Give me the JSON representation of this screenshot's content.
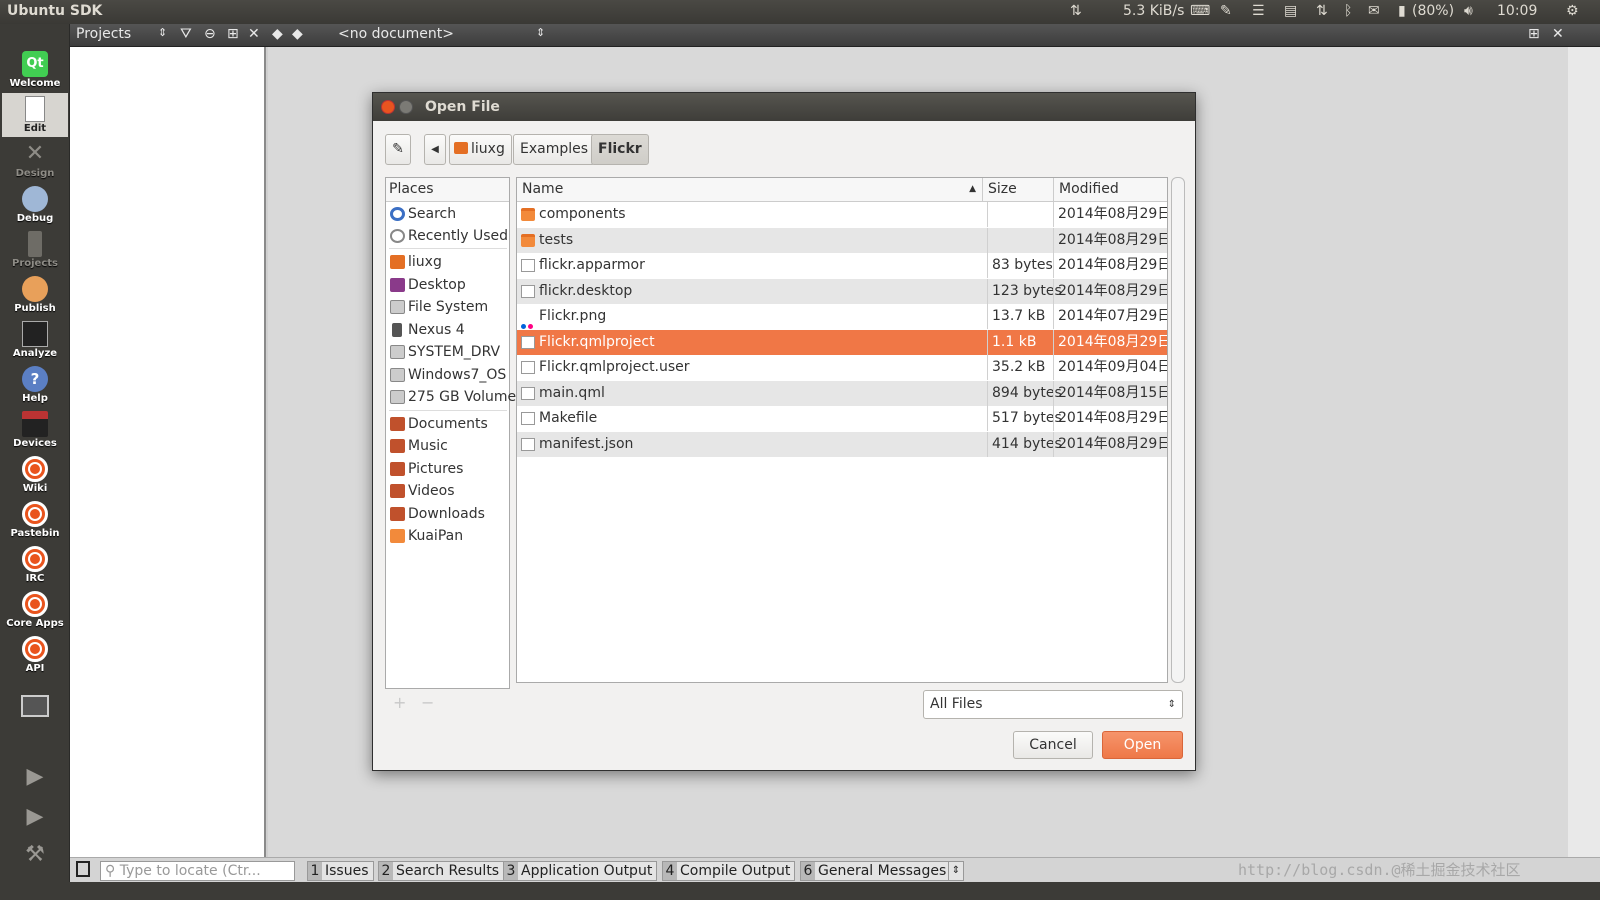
{
  "topbar": {
    "app_name": "Ubuntu SDK",
    "net_speed": "5.3 KiB/s",
    "battery": "(80%)",
    "clock": "10:09"
  },
  "launcher": {
    "items": [
      {
        "label": "Welcome",
        "icon": "qt-logo-icon"
      },
      {
        "label": "Edit",
        "icon": "edit-document-icon"
      },
      {
        "label": "Design",
        "icon": "design-tools-icon"
      },
      {
        "label": "Debug",
        "icon": "debug-bug-icon"
      },
      {
        "label": "Projects",
        "icon": "projects-icon"
      },
      {
        "label": "Publish",
        "icon": "publish-icon"
      },
      {
        "label": "Analyze",
        "icon": "analyze-icon"
      },
      {
        "label": "Help",
        "icon": "help-icon"
      },
      {
        "label": "Devices",
        "icon": "devices-icon"
      },
      {
        "label": "Wiki",
        "icon": "ubuntu-icon"
      },
      {
        "label": "Pastebin",
        "icon": "ubuntu-icon"
      },
      {
        "label": "IRC",
        "icon": "ubuntu-icon"
      },
      {
        "label": "Core Apps",
        "icon": "ubuntu-icon"
      },
      {
        "label": "API",
        "icon": "ubuntu-icon"
      }
    ]
  },
  "toolbar": {
    "projects_label": "Projects",
    "document_label": "<no document>"
  },
  "bottombar": {
    "locate_placeholder": "Type to locate (Ctr...",
    "tabs": [
      {
        "num": "1",
        "label": "Issues"
      },
      {
        "num": "2",
        "label": "Search Results"
      },
      {
        "num": "3",
        "label": "Application Output"
      },
      {
        "num": "4",
        "label": "Compile Output"
      },
      {
        "num": "6",
        "label": "General Messages"
      }
    ],
    "watermark": "http://blog.csdn.@稀土掘金技术社区"
  },
  "dialog": {
    "title": "Open File",
    "breadcrumbs": [
      "liuxg",
      "Examples",
      "Flickr"
    ],
    "places_header": "Places",
    "places": [
      {
        "label": "Search",
        "color": "#3b6fc4"
      },
      {
        "label": "Recently Used",
        "color": "#9a9a9a"
      },
      {
        "label": "liuxg",
        "color": "#e46f24"
      },
      {
        "label": "Desktop",
        "color": "#8a3a8a"
      },
      {
        "label": "File System",
        "color": "#888888"
      },
      {
        "label": "Nexus 4",
        "color": "#555555"
      },
      {
        "label": "SYSTEM_DRV",
        "color": "#888888"
      },
      {
        "label": "Windows7_OS",
        "color": "#888888"
      },
      {
        "label": "275 GB Volume",
        "color": "#888888"
      },
      {
        "label": "Documents",
        "color": "#c0512c"
      },
      {
        "label": "Music",
        "color": "#c0512c"
      },
      {
        "label": "Pictures",
        "color": "#c0512c"
      },
      {
        "label": "Videos",
        "color": "#c0512c"
      },
      {
        "label": "Downloads",
        "color": "#c0512c"
      },
      {
        "label": "KuaiPan",
        "color": "#f28a3b"
      }
    ],
    "columns": {
      "name": "Name",
      "size": "Size",
      "modified": "Modified"
    },
    "files": [
      {
        "name": "components",
        "size": "",
        "modified": "2014年08月29日",
        "type": "folder"
      },
      {
        "name": "tests",
        "size": "",
        "modified": "2014年08月29日",
        "type": "folder"
      },
      {
        "name": "flickr.apparmor",
        "size": "83 bytes",
        "modified": "2014年08月29日",
        "type": "file"
      },
      {
        "name": "flickr.desktop",
        "size": "123 bytes",
        "modified": "2014年08月29日",
        "type": "file"
      },
      {
        "name": "Flickr.png",
        "size": "13.7 kB",
        "modified": "2014年07月29日",
        "type": "image"
      },
      {
        "name": "Flickr.qmlproject",
        "size": "1.1 kB",
        "modified": "2014年08月29日",
        "type": "file",
        "selected": true
      },
      {
        "name": "Flickr.qmlproject.user",
        "size": "35.2 kB",
        "modified": "2014年09月04日",
        "type": "file"
      },
      {
        "name": "main.qml",
        "size": "894 bytes",
        "modified": "2014年08月15日",
        "type": "file"
      },
      {
        "name": "Makefile",
        "size": "517 bytes",
        "modified": "2014年08月29日",
        "type": "file"
      },
      {
        "name": "manifest.json",
        "size": "414 bytes",
        "modified": "2014年08月29日",
        "type": "file"
      }
    ],
    "filter": "All Files",
    "cancel_label": "Cancel",
    "open_label": "Open"
  },
  "colors": {
    "accent": "#f07746",
    "launcher_bg": "#3c3b37"
  }
}
